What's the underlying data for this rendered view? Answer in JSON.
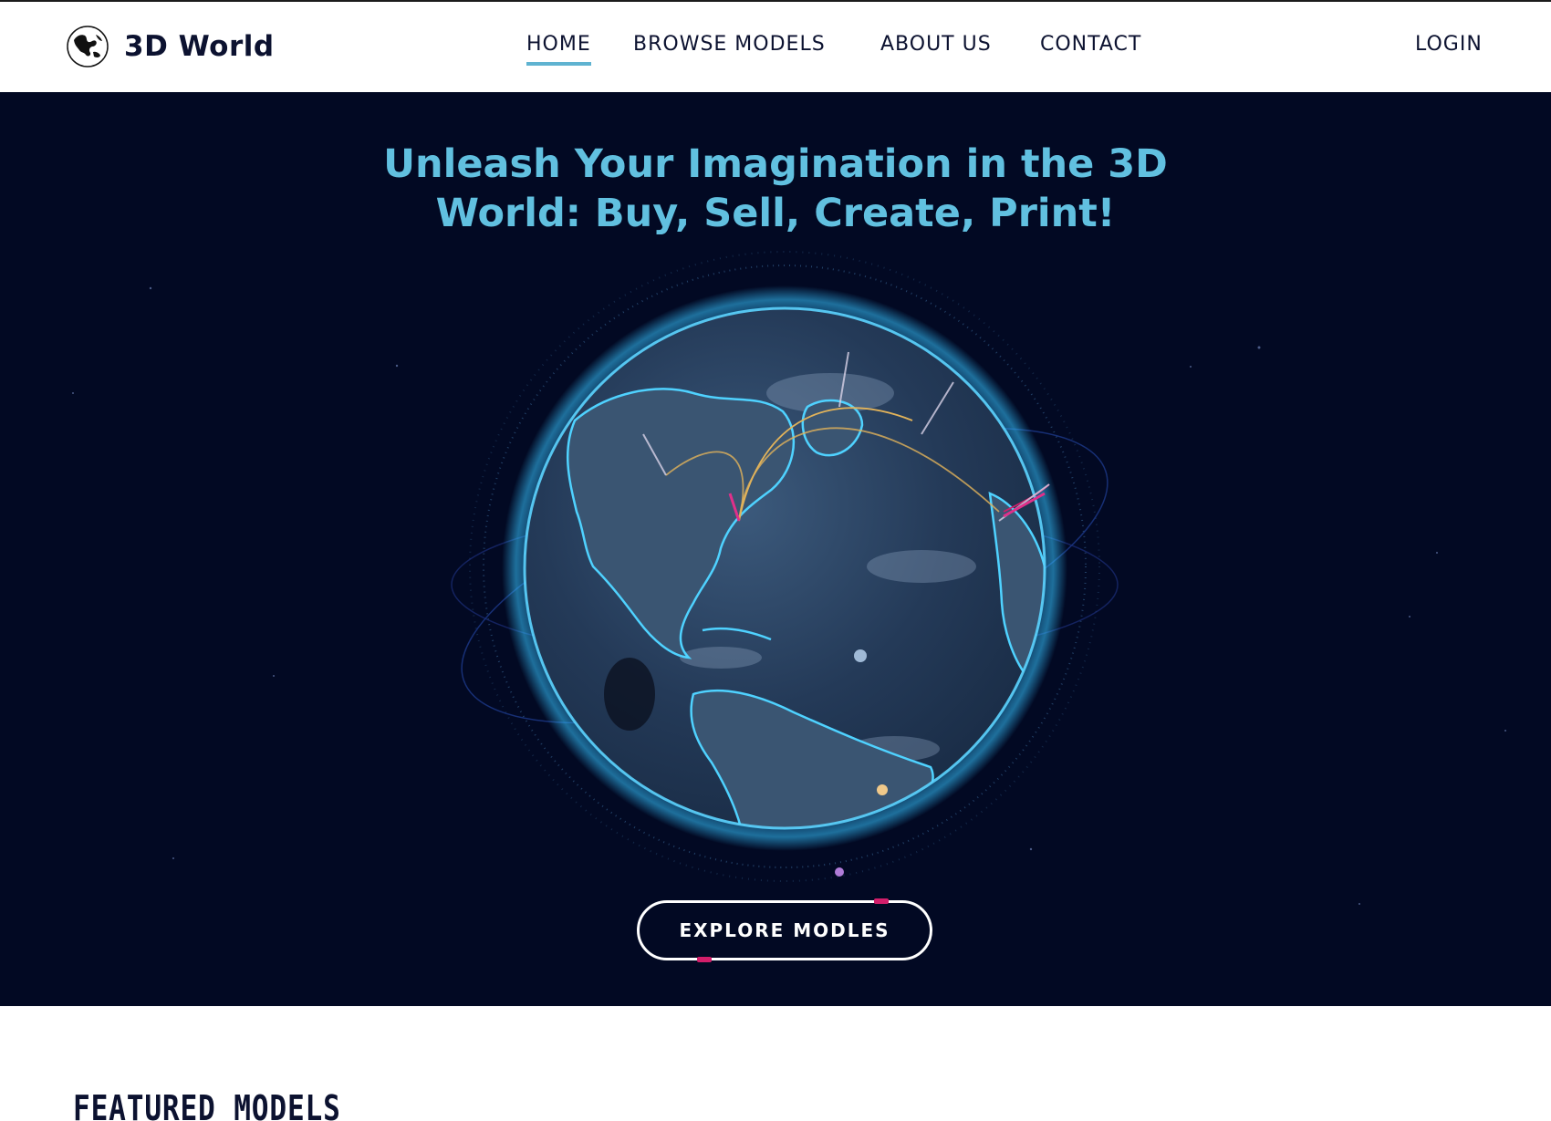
{
  "brand": {
    "name": "3D World",
    "logo_icon": "globe-icon"
  },
  "nav": {
    "items": [
      {
        "label": "HOME",
        "active": true
      },
      {
        "label": "BROWSE MODELS",
        "active": false
      },
      {
        "label": "ABOUT US",
        "active": false
      },
      {
        "label": "CONTACT",
        "active": false
      }
    ],
    "login_label": "LOGIN"
  },
  "hero": {
    "title_line1": "Unleash Your Imagination in the 3D",
    "title_line2": "World: Buy, Sell, Create, Print!",
    "cta_label": "EXPLORE MODLES",
    "globe_icon": "earth-globe-illustration"
  },
  "featured": {
    "title": "FEATURED MODELS"
  },
  "colors": {
    "hero_bg": "#020923",
    "accent": "#61c0e0",
    "nav_text": "#0c1230",
    "active_underline": "#5fb3d1",
    "cta_tick": "#d21e6a"
  }
}
